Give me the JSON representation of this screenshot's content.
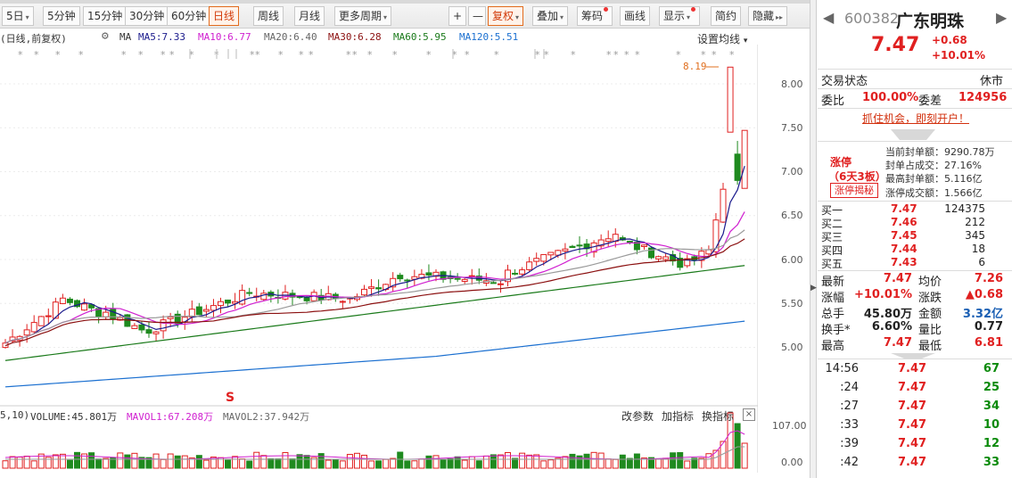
{
  "toolbar": {
    "periods": [
      "5日",
      "5分钟",
      "15分钟",
      "30分钟",
      "60分钟",
      "日线",
      "周线",
      "月线",
      "更多周期"
    ],
    "active_period": "日线",
    "zoom_in": "+",
    "zoom_out": "—",
    "adjust": "复权",
    "overlay": "叠加",
    "chips": "筹码",
    "draw": "画线",
    "display": "显示",
    "simple": "简约",
    "hide": "隐藏"
  },
  "legend": {
    "prefix": "(日线,前复权)",
    "ma": "MA",
    "ma5": "MA5:7.33",
    "ma10": "MA10:6.77",
    "ma20": "MA20:6.40",
    "ma30": "MA30:6.28",
    "ma60": "MA60:5.95",
    "ma120": "MA120:5.51",
    "setting": "设置均线"
  },
  "colors": {
    "up": "#e02020",
    "down": "#1f8a1f",
    "ma5": "#1a1a8c",
    "ma10": "#d020d0",
    "ma20": "#9a9a9a",
    "ma30": "#8b1010",
    "ma60": "#1a7a1a",
    "ma120": "#1a6fd0"
  },
  "price_axis": [
    "8.00",
    "7.50",
    "7.00",
    "6.50",
    "6.00",
    "5.50",
    "5.00"
  ],
  "max_marker": "8.19",
  "s_marker": "S",
  "volume": {
    "prefix": "5,10)",
    "vol": "VOLUME:45.801万",
    "mavol1": "MAVOL1:67.208万",
    "mavol2": "MAVOL2:37.942万",
    "change_params": "改参数",
    "add_indicator": "加指标",
    "switch_indicator": "换指标",
    "close": "×",
    "axis_top": "107.00",
    "axis_bottom": "0.00"
  },
  "quote": {
    "code": "600382",
    "name": "广东明珠",
    "price": "7.47",
    "change": "+0.68",
    "change_pct": "+10.01%",
    "trade_state_label": "交易状态",
    "trade_state": "休市",
    "weibi_label": "委比",
    "weibi": "100.00%",
    "weicha_label": "委差",
    "weicha": "124956",
    "promo": "抓住机会，即刻开户！",
    "limit_up": "涨停",
    "limit_days": "（6天3板）",
    "limit_btn": "涨停揭秘",
    "seal_amount": "当前封单额：9290.78万",
    "seal_ratio": "封单占成交：27.16%",
    "max_seal": "最高封单额：5.116亿",
    "limit_turnover": "涨停成交额：1.566亿"
  },
  "order_book": [
    {
      "label": "买一",
      "price": "7.47",
      "vol": "124375"
    },
    {
      "label": "买二",
      "price": "7.46",
      "vol": "212"
    },
    {
      "label": "买三",
      "price": "7.45",
      "vol": "345"
    },
    {
      "label": "买四",
      "price": "7.44",
      "vol": "18"
    },
    {
      "label": "买五",
      "price": "7.43",
      "vol": "6"
    }
  ],
  "stats": [
    {
      "l1": "最新",
      "v1": "7.47",
      "c1": "red",
      "l2": "均价",
      "v2": "7.26",
      "c2": "red"
    },
    {
      "l1": "涨幅",
      "v1": "+10.01%",
      "c1": "red",
      "l2": "涨跌",
      "v2": "▲0.68",
      "c2": "red"
    },
    {
      "l1": "总手",
      "v1": "45.80万",
      "c1": "dark",
      "l2": "金额",
      "v2": "3.32亿",
      "c2": "blue"
    },
    {
      "l1": "换手*",
      "v1": "6.60%",
      "c1": "dark",
      "l2": "量比",
      "v2": "0.77",
      "c2": "dark"
    },
    {
      "l1": "最高",
      "v1": "7.47",
      "c1": "red",
      "l2": "最低",
      "v2": "6.81",
      "c2": "red"
    }
  ],
  "ticks": [
    {
      "time": "14:56",
      "price": "7.47",
      "vol": "67"
    },
    {
      "time": ":24",
      "price": "7.47",
      "vol": "25"
    },
    {
      "time": ":27",
      "price": "7.47",
      "vol": "34"
    },
    {
      "time": ":33",
      "price": "7.47",
      "vol": "10"
    },
    {
      "time": ":39",
      "price": "7.47",
      "vol": "12"
    },
    {
      "time": ":42",
      "price": "7.47",
      "vol": "33"
    }
  ]
}
